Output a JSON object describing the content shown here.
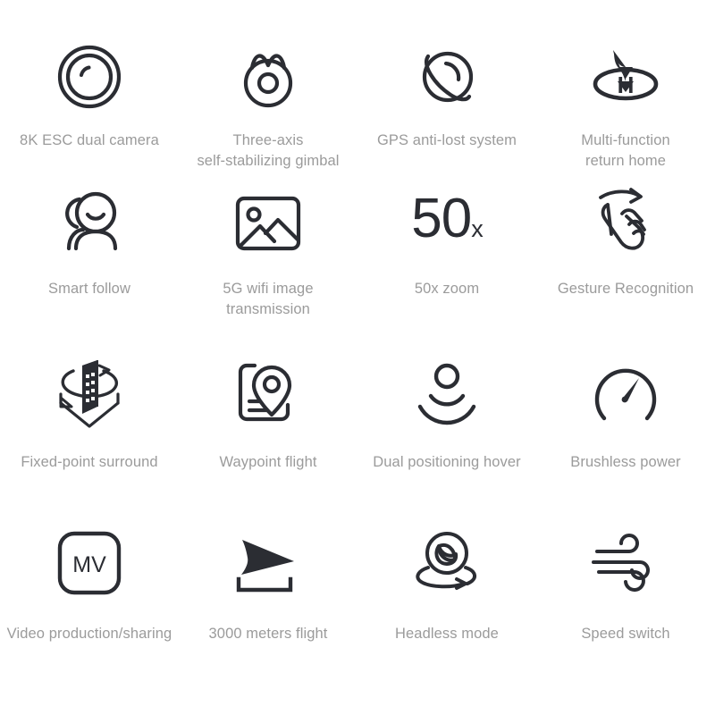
{
  "theme": {
    "background": "#ffffff",
    "icon_color": "#2b2d33",
    "label_color": "#9b9b9b"
  },
  "features": [
    {
      "icon": "camera-lens-icon",
      "label": "8K ESC dual camera"
    },
    {
      "icon": "gimbal-icon",
      "label": "Three-axis\nself-stabilizing gimbal"
    },
    {
      "icon": "gps-globe-orbit-icon",
      "label": "GPS anti-lost system"
    },
    {
      "icon": "return-home-icon",
      "label": "Multi-function\nreturn home"
    },
    {
      "icon": "people-follow-icon",
      "label": "Smart follow"
    },
    {
      "icon": "photo-image-icon",
      "label": "5G wifi image\ntransmission"
    },
    {
      "icon": "zoom-50x-text-icon",
      "label": "50x zoom",
      "display_number": "50",
      "display_suffix": "x"
    },
    {
      "icon": "hand-gesture-swipe-icon",
      "label": "Gesture Recognition"
    },
    {
      "icon": "building-orbit-icon",
      "label": "Fixed-point surround"
    },
    {
      "icon": "map-waypoint-pin-icon",
      "label": "Waypoint flight"
    },
    {
      "icon": "positioning-signal-icon",
      "label": "Dual positioning hover"
    },
    {
      "icon": "speedometer-gauge-icon",
      "label": "Brushless power"
    },
    {
      "icon": "mv-badge-icon",
      "label": "Video production/sharing",
      "badge_text": "MV"
    },
    {
      "icon": "arrow-distance-icon",
      "label": "3000 meters flight"
    },
    {
      "icon": "headless-rotation-icon",
      "label": "Headless mode"
    },
    {
      "icon": "wind-speed-icon",
      "label": "Speed switch"
    }
  ]
}
